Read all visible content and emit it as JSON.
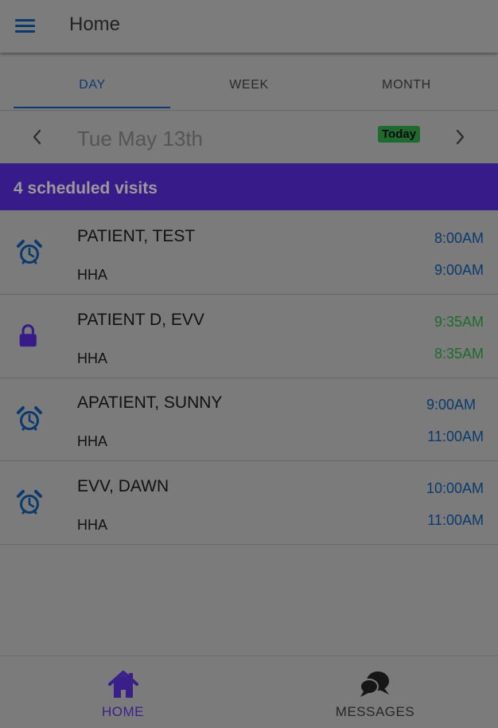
{
  "header": {
    "title": "Home",
    "menu_icon": "hamburger-menu-icon"
  },
  "tabs": [
    {
      "label": "DAY",
      "active": true
    },
    {
      "label": "WEEK",
      "active": false
    },
    {
      "label": "MONTH",
      "active": false
    }
  ],
  "date_nav": {
    "date": "Tue May 13th",
    "today_label": "Today"
  },
  "banner": {
    "text": "4 scheduled visits",
    "color": "#371b89"
  },
  "visits": [
    {
      "name": "PATIENT, TEST",
      "service": "HHA",
      "start": "8:00AM",
      "end": "9:00AM",
      "icon": "alarm-clock-icon",
      "time_color": "#0b3a6e"
    },
    {
      "name": "PATIENT D, EVV",
      "service": "HHA",
      "start": "9:35AM",
      "end": "8:35AM",
      "icon": "lock-icon",
      "time_color": "#1e6b2b"
    },
    {
      "name": "APATIENT, SUNNY",
      "service": "HHA",
      "start": "9:00AM",
      "end": "11:00AM",
      "icon": "alarm-clock-icon",
      "time_color": "#0b3a6e"
    },
    {
      "name": "EVV, DAWN",
      "service": "HHA",
      "start": "10:00AM",
      "end": "11:00AM",
      "icon": "alarm-clock-icon",
      "time_color": "#0b3a6e"
    }
  ],
  "bottom_nav": {
    "home_label": "HOME",
    "messages_label": "MESSAGES",
    "home_icon": "home-icon",
    "messages_icon": "chat-bubbles-icon"
  },
  "colors": {
    "accent_blue": "#0b3a6e",
    "accent_purple": "#371b89",
    "status_green": "#1e6b2b"
  }
}
